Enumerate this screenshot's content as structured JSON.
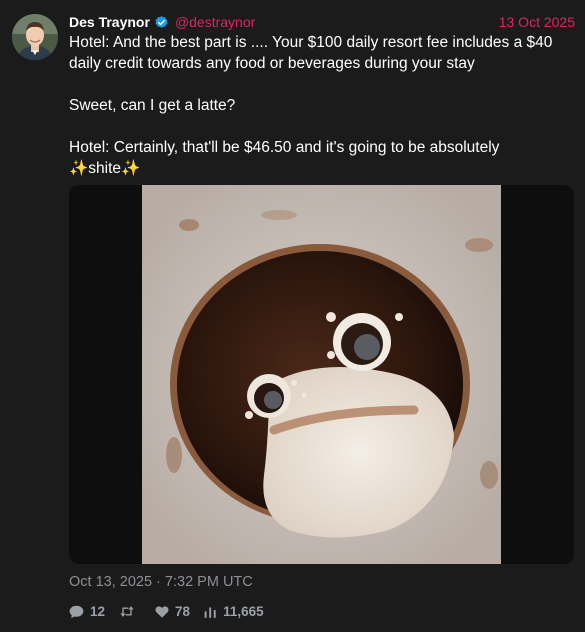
{
  "author": {
    "name": "Des Traynor",
    "handle": "@destraynor",
    "date": "13 Oct 2025"
  },
  "tweet": {
    "lines": [
      "Hotel: And the best part is .... Your $100 daily resort fee includes a $40 daily credit towards any food or beverages during your stay",
      "Sweet, can I get a latte?",
      "Hotel: Certainly, that'll be $46.50 and it's going to be absolutely",
      "✨shite✨"
    ],
    "timestamp": "Oct 13, 2025 · 7:32 PM UTC"
  },
  "stats": {
    "replies": "12",
    "retweets": "",
    "likes": "78",
    "views": "11,665"
  },
  "colors": {
    "background": "#1b1b1b",
    "accent": "#e0245e",
    "verified": "#1d9bf0",
    "muted": "#8b8f94"
  },
  "icons": [
    "verified-badge-icon",
    "reply-icon",
    "retweet-icon",
    "like-icon",
    "views-icon"
  ]
}
